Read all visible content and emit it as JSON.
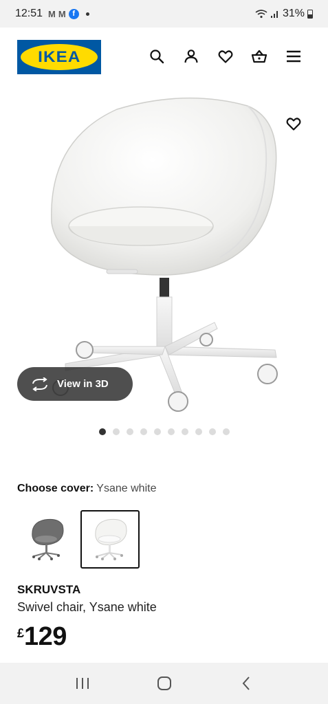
{
  "status_bar": {
    "time": "12:51",
    "notification_icons": [
      "M",
      "M"
    ],
    "battery": "31%"
  },
  "header": {
    "logo_text": "IKEA",
    "icons": [
      "search-icon",
      "account-icon",
      "wishlist-heart-icon",
      "basket-icon",
      "menu-icon"
    ]
  },
  "product": {
    "image_desc_icons": [
      "favourite-heart-icon"
    ],
    "view_3d_label": "View in 3D",
    "carousel": {
      "total": 10,
      "active_index": 0
    },
    "choose_cover_label": "Choose cover:",
    "choose_cover_value": "Ysane white",
    "variants": [
      {
        "name": "grey",
        "selected": false
      },
      {
        "name": "white",
        "selected": true
      }
    ],
    "name": "SKRUVSTA",
    "description": "Swivel chair, Ysane white",
    "price_currency": "£",
    "price_amount": "129"
  },
  "colors": {
    "ikea_blue": "#0058a3",
    "ikea_yellow": "#ffdb00"
  }
}
